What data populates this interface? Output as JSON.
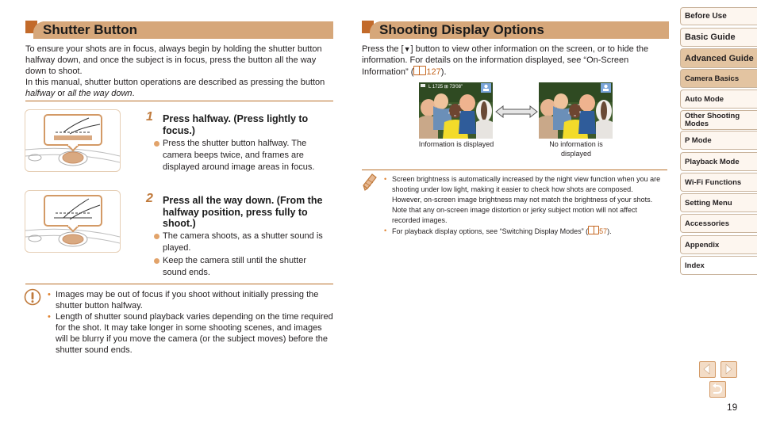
{
  "shutter_section": {
    "title": "Shutter Button",
    "intro": [
      "To ensure your shots are in focus, always begin by holding the shutter button halfway down, and once the subject is in focus, press the button all the way down to shoot.",
      "In this manual, shutter button operations are described as pressing the button",
      "halfway",
      "or",
      "all the way down",
      "."
    ],
    "steps": [
      {
        "number": "1",
        "title": "Press halfway. (Press lightly to focus.)",
        "bullets": [
          "Press the shutter button halfway. The camera beeps twice, and frames are displayed around image areas in focus."
        ]
      },
      {
        "number": "2",
        "title": "Press all the way down. (From the halfway position, press fully to shoot.)",
        "bullets": [
          "The camera shoots, as a shutter sound is played.",
          "Keep the camera still until the shutter sound ends."
        ]
      }
    ],
    "caution_icon": "caution-icon",
    "cautions": [
      "Images may be out of focus if you shoot without initially pressing the shutter button halfway.",
      "Length of shutter sound playback varies depending on the time required for the shot. It may take longer in some shooting scenes, and images will be blurry if you move the camera (or the subject moves) before the shutter sound ends."
    ]
  },
  "display_section": {
    "title": "Shooting Display Options",
    "intro_a": "Press the [",
    "button_glyph": "▼",
    "intro_b": "] button to view other information on the screen, or to hide the information. For details on the information displayed, see “On-Screen Information” (",
    "intro_ref": "127",
    "intro_c": ").",
    "screen_overlay": "L  1725  ⊞ 73'08\"",
    "captions": [
      "Information is displayed",
      "No information is displayed"
    ],
    "note_icon": "pencil-icon",
    "notes": [
      {
        "text": "Screen brightness is automatically increased by the night view function when you are shooting under low light, making it easier to check how shots are composed. However, on-screen image brightness may not match the brightness of your shots. Note that any on-screen image distortion or jerky subject motion will not affect recorded images."
      },
      {
        "text": "For playback display options, see “Switching Display Modes” (",
        "ref": "57",
        "tail": ")."
      }
    ]
  },
  "nav": {
    "items": [
      {
        "label": "Before Use",
        "active": false
      },
      {
        "label": "Basic Guide",
        "active": false
      },
      {
        "label": "Advanced Guide",
        "active": true
      },
      {
        "label": "Camera Basics",
        "active": true
      },
      {
        "label": "Auto Mode",
        "active": false
      },
      {
        "label": "Other Shooting Modes",
        "active": false
      },
      {
        "label": "P Mode",
        "active": false
      },
      {
        "label": "Playback Mode",
        "active": false
      },
      {
        "label": "Wi-Fi Functions",
        "active": false
      },
      {
        "label": "Setting Menu",
        "active": false
      },
      {
        "label": "Accessories",
        "active": false
      },
      {
        "label": "Appendix",
        "active": false
      },
      {
        "label": "Index",
        "active": false
      }
    ],
    "prev_icon": "previous-page-icon",
    "next_icon": "next-page-icon",
    "return_icon": "return-icon"
  },
  "page_number": "19"
}
